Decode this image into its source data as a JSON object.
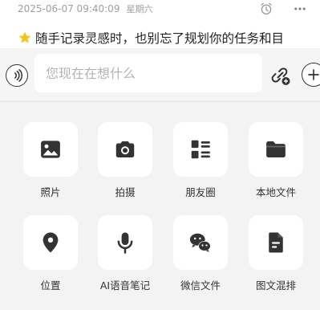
{
  "note": {
    "timestamp": "2025-06-07 09:40:09",
    "weekday": "星期六",
    "preview": "随手记录灵感时，也别忘了规划你的任务和目"
  },
  "composer": {
    "placeholder": "您现在在想什么"
  },
  "attachments": [
    {
      "label": "照片",
      "icon": "photo-icon"
    },
    {
      "label": "拍摄",
      "icon": "camera-icon"
    },
    {
      "label": "朋友圈",
      "icon": "moments-icon"
    },
    {
      "label": "本地文件",
      "icon": "folder-icon"
    },
    {
      "label": "位置",
      "icon": "location-icon"
    },
    {
      "label": "AI语音笔记",
      "icon": "microphone-icon"
    },
    {
      "label": "微信文件",
      "icon": "wechat-icon"
    },
    {
      "label": "图文混排",
      "icon": "document-icon"
    }
  ],
  "colors": {
    "icon": "#333333",
    "tile_bg": "#ffffff",
    "panel_bg": "#f3f3f3",
    "star": "#f5c518"
  }
}
